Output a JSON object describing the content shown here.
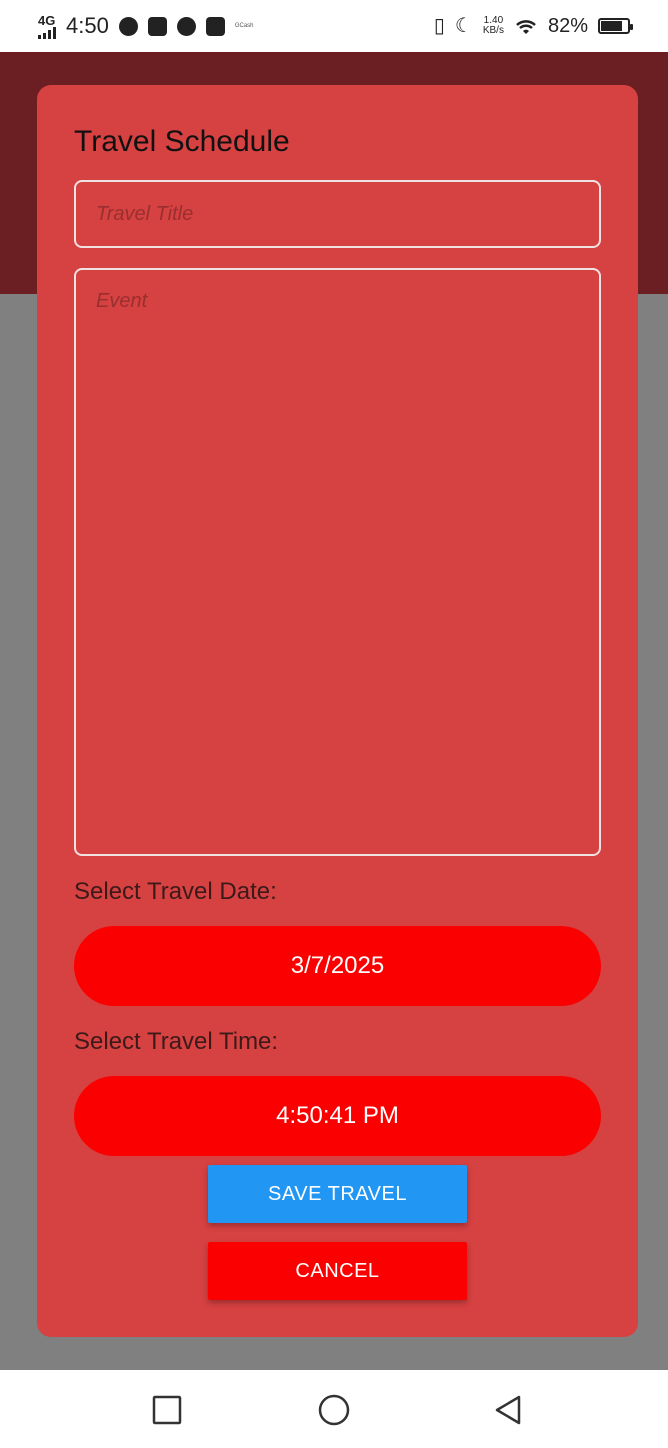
{
  "status_bar": {
    "network": "4G",
    "time": "4:50",
    "notification_icons": [
      "messenger-icon",
      "shopee-icon",
      "angular-icon",
      "mail-icon"
    ],
    "small_text": "GCash",
    "speed_value": "1.40",
    "speed_unit": "KB/s",
    "battery_percent": "82%",
    "battery_level": 0.82
  },
  "modal": {
    "title": "Travel Schedule",
    "title_placeholder": "Travel Title",
    "title_value": "",
    "event_placeholder": "Event",
    "event_value": "",
    "date_label": "Select Travel Date:",
    "date_value": "3/7/2025",
    "time_label": "Select Travel Time:",
    "time_value": "4:50:41 PM",
    "save_label": "SAVE TRAVEL",
    "cancel_label": "CANCEL"
  },
  "colors": {
    "modal_bg": "#d64141",
    "header_bg": "#6b1f22",
    "pill_bg": "#fa0000",
    "save_bg": "#2196f3",
    "cancel_bg": "#fa0000"
  },
  "nav_bar": {
    "buttons": [
      "recents-icon",
      "home-icon",
      "back-icon"
    ]
  }
}
